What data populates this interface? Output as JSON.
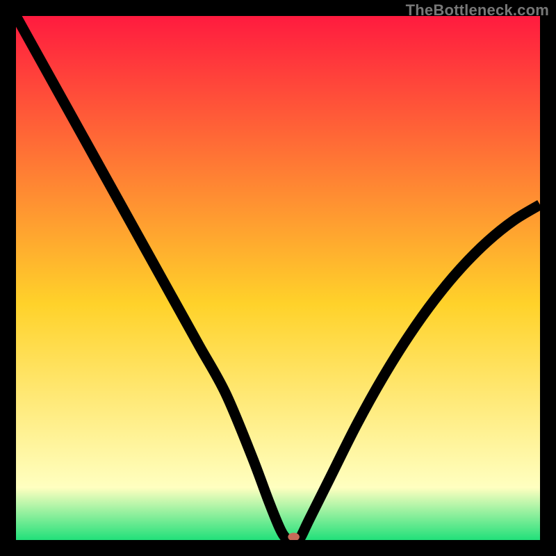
{
  "watermark": "TheBottleneck.com",
  "colors": {
    "curve": "#000000",
    "marker": "#c66a58",
    "gradient_top": "#ff1b3f",
    "gradient_mid": "#ffd22a",
    "gradient_low": "#ffffc0",
    "gradient_bottom": "#21e07a",
    "background": "#000000"
  },
  "chart_data": {
    "type": "line",
    "title": "",
    "xlabel": "",
    "ylabel": "",
    "xlim": [
      0,
      100
    ],
    "ylim": [
      0,
      100
    ],
    "grid": false,
    "legend": false,
    "series": [
      {
        "name": "bottleneck-curve",
        "x": [
          0,
          5,
          10,
          15,
          20,
          25,
          30,
          35,
          40,
          45,
          48,
          50,
          51,
          52,
          53,
          54,
          56,
          60,
          65,
          70,
          75,
          80,
          85,
          90,
          95,
          100
        ],
        "y": [
          100,
          91,
          82,
          73,
          64,
          55,
          46,
          37,
          28,
          16,
          8,
          3,
          1,
          0,
          0,
          0,
          4,
          12,
          22,
          31,
          39,
          46,
          52,
          57,
          61,
          64
        ]
      }
    ],
    "marker": {
      "x": 53,
      "y": 0
    }
  }
}
